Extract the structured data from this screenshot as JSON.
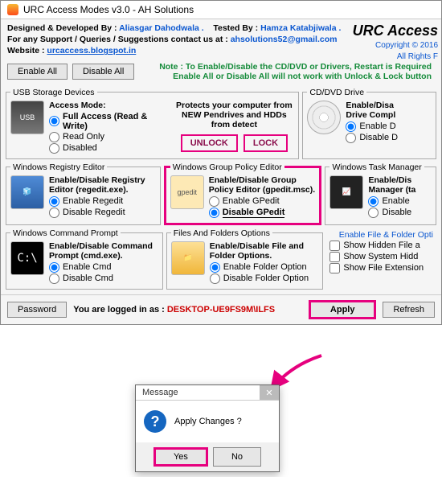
{
  "title": "URC Access Modes v3.0 - AH Solutions",
  "brand": {
    "name": "URC Access",
    "copyright": "Copyright © 2016",
    "rights": "All Rights F"
  },
  "credits": {
    "dev_label": "Designed & Developed By : ",
    "dev_name": "Aliasgar Dahodwala .",
    "test_label": "Tested By : ",
    "test_name": "Hamza Katabjiwala .",
    "support_label": "For any Support / Queries / Suggestions contact us at : ",
    "support_email": "ahsolutions52@gmail.com",
    "website_label": "Website : ",
    "website_url": "urcaccess.blogspot.in"
  },
  "note_line1": "Note : To Enable/Disable the CD/DVD or Drivers, Restart is Required",
  "note_line2": "Enable All or Disable All will not work with Unlock & Lock button",
  "toolbar": {
    "enable_all": "Enable All",
    "disable_all": "Disable All"
  },
  "usb": {
    "legend": "USB Storage Devices",
    "mode_label": "Access Mode:",
    "opt_full": "Full Access (Read & Write)",
    "opt_ro": "Read Only",
    "opt_disabled": "Disabled"
  },
  "protect": {
    "desc": "Protects your computer from NEW Pendrives and HDDs from detect",
    "unlock": "UNLOCK",
    "lock": "LOCK"
  },
  "cd": {
    "legend": "CD/DVD Drive",
    "desc": "Enable/Disa\nDrive Compl",
    "opt_enable": "Enable D",
    "opt_disable": "Disable D"
  },
  "reg": {
    "legend": "Windows Registry Editor",
    "desc": "Enable/Disable Registry Editor (regedit.exe).",
    "opt_enable": "Enable Regedit",
    "opt_disable": "Disable Regedit"
  },
  "gp": {
    "legend": "Windows Group Policy Editor",
    "desc": "Enable/Disable Group Policy Editor (gpedit.msc).",
    "opt_enable": "Enable GPedit",
    "opt_disable": "Disable GPedit"
  },
  "tm": {
    "legend": "Windows Task Manager",
    "desc": "Enable/Dis\nManager (ta",
    "opt_enable": "Enable",
    "opt_disable": "Disable"
  },
  "cmd": {
    "legend": "Windows Command Prompt",
    "desc": "Enable/Disable Command Prompt (cmd.exe).",
    "opt_enable": "Enable Cmd",
    "opt_disable": "Disable Cmd"
  },
  "ff": {
    "legend": "Files And Folders Options",
    "desc": "Enable/Disable File and Folder Options.",
    "opt_enable": "Enable Folder Option",
    "opt_disable": "Disable Folder Option"
  },
  "ff_right": {
    "link": "Enable File & Folder Opti",
    "item1": "Show Hidden File a",
    "item2": "Show System Hidd",
    "item3": "Show File Extension"
  },
  "status": {
    "pwd_btn": "Password",
    "login_label": "You are logged in as : ",
    "login_user": "DESKTOP-UE9FS9M\\ILFS",
    "apply": "Apply",
    "refresh": "Refresh"
  },
  "dialog": {
    "title": "Message",
    "text": "Apply Changes ?",
    "yes": "Yes",
    "no": "No"
  }
}
